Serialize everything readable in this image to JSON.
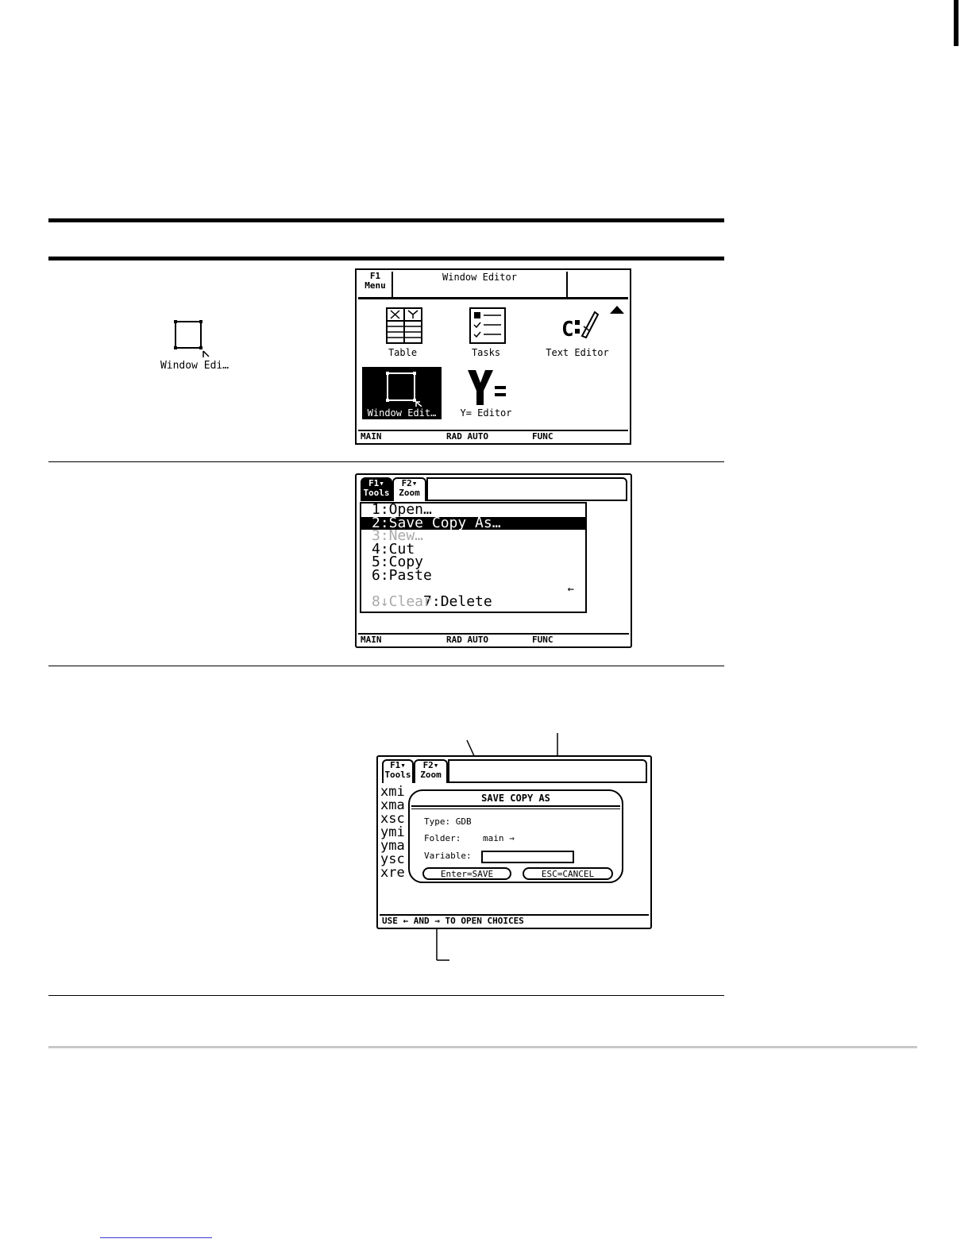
{
  "left_icon": {
    "label": "Window Edi…"
  },
  "screen1": {
    "f1_line1": "F1",
    "f1_line2": "Menu",
    "title": "Window Editor",
    "apps": [
      {
        "label": "Table",
        "icon": "table-icon"
      },
      {
        "label": "Tasks",
        "icon": "tasks-icon"
      },
      {
        "label": "Text Editor",
        "icon": "text-editor-icon"
      },
      {
        "label": "Window Edit…",
        "icon": "window-editor-icon",
        "selected": true
      },
      {
        "label": "Y= Editor",
        "icon": "y-editor-icon"
      }
    ],
    "status": {
      "mode": "MAIN",
      "angle": "RAD AUTO",
      "graph": "FUNC"
    }
  },
  "screen2": {
    "tab1_top": "F1▾",
    "tab1_bottom": "Tools",
    "tab2_top": "F2▾",
    "tab2_bottom": "Zoom",
    "menu_items": [
      {
        "text": "1:Open…"
      },
      {
        "text": "2:Save Copy As…",
        "selected": true
      },
      {
        "text": "3:New…",
        "disabled": true
      },
      {
        "text": "4:Cut"
      },
      {
        "text": "5:Copy"
      },
      {
        "text": "6:Paste"
      },
      {
        "text": "7:Delete",
        "shortcut": "←"
      },
      {
        "text": "8↓Clear",
        "disabled": true
      }
    ],
    "status": {
      "mode": "MAIN",
      "angle": "RAD AUTO",
      "graph": "FUNC"
    }
  },
  "screen3": {
    "tab1_top": "F1▾",
    "tab1_bottom": "Tools",
    "tab2_top": "F2▾",
    "tab2_bottom": "Zoom",
    "background_vars": [
      "xmi",
      "xma",
      "xsc",
      "ymi",
      "yma",
      "ysc",
      "xre"
    ],
    "dialog": {
      "title": "SAVE COPY AS",
      "type_label": "Type: GDB",
      "folder_label": "Folder:",
      "folder_value": "main →",
      "variable_label": "Variable:",
      "variable_value": "",
      "enter_button": "Enter=SAVE",
      "esc_button": "ESC=CANCEL"
    },
    "status": "USE ← AND → TO OPEN CHOICES"
  }
}
